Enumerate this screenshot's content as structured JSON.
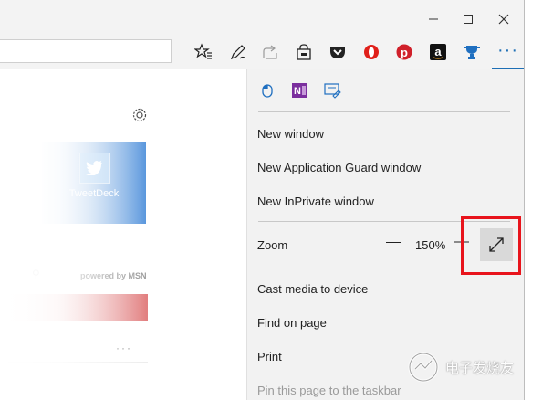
{
  "window": {
    "minimize_icon": "minimize-icon",
    "maximize_icon": "maximize-icon",
    "close_icon": "close-icon"
  },
  "toolbar": {
    "address_value": "",
    "icons": [
      "favorites-list-icon",
      "pen-icon",
      "share-icon",
      "reading-list-lock-icon",
      "pocket-icon",
      "opera-icon",
      "pinterest-icon",
      "amazon-icon",
      "extension-trophy-icon"
    ],
    "more_label": "···",
    "accent": "#1e6fb5"
  },
  "page": {
    "tile_label": "TweetDeck",
    "powered_by": "powered by MSN",
    "more_dots": "···"
  },
  "menu": {
    "extension_icons": [
      "mouse-extension-icon",
      "onenote-icon",
      "web-note-icon"
    ],
    "new_window": "New window",
    "new_guard_window": "New Application Guard window",
    "new_inprivate_window": "New InPrivate window",
    "zoom_label": "Zoom",
    "zoom_value": "150%",
    "cast": "Cast media to device",
    "find": "Find on page",
    "print": "Print",
    "pin": "Pin this page to the taskbar"
  },
  "highlight_color": "#e8141c",
  "watermark_text": "电子发烧友"
}
